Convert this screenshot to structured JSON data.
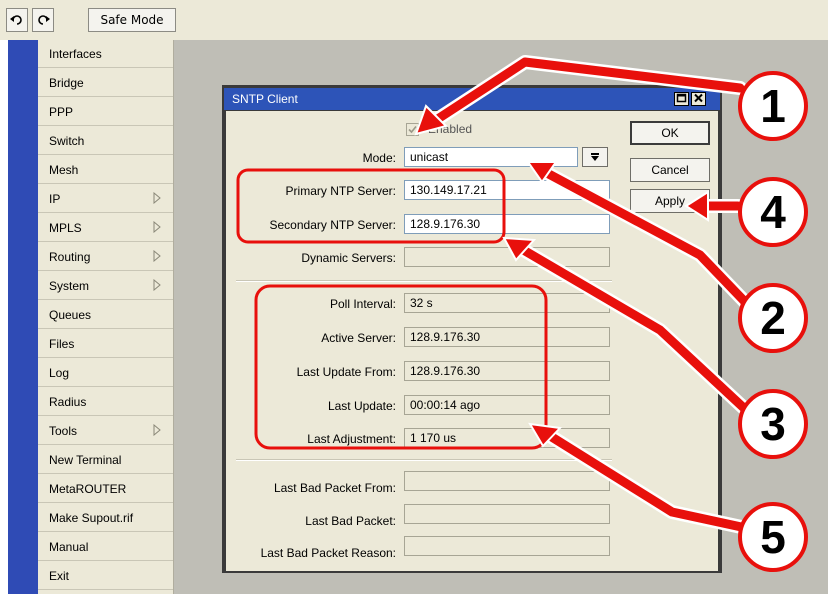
{
  "toolbar": {
    "undo_icon": "undo-icon",
    "redo_icon": "redo-icon",
    "safe_mode": "Safe Mode"
  },
  "menu": [
    "Interfaces",
    "Bridge",
    "PPP",
    "Switch",
    "Mesh",
    "IP",
    "MPLS",
    "Routing",
    "System",
    "Queues",
    "Files",
    "Log",
    "Radius",
    "Tools",
    "New Terminal",
    "MetaROUTER",
    "Make Supout.rif",
    "Manual",
    "Exit"
  ],
  "menu_submenus": [
    "IP",
    "MPLS",
    "Routing",
    "System",
    "Tools"
  ],
  "window": {
    "title": "SNTP Client",
    "enabled_label": "Enabled",
    "mode_label": "Mode:",
    "mode_value": "unicast",
    "primary_label": "Primary NTP Server:",
    "primary_value": "130.149.17.21",
    "secondary_label": "Secondary NTP Server:",
    "secondary_value": "128.9.176.30",
    "dynamic_label": "Dynamic Servers:",
    "dynamic_value": "",
    "poll_label": "Poll Interval:",
    "poll_value": "32 s",
    "active_label": "Active Server:",
    "active_value": "128.9.176.30",
    "last_from_label": "Last Update From:",
    "last_from_value": "128.9.176.30",
    "last_update_label": "Last Update:",
    "last_update_value": "00:00:14 ago",
    "last_adj_label": "Last Adjustment:",
    "last_adj_value": "1 170 us",
    "bad_from_label": "Last Bad Packet From:",
    "bad_from_value": "",
    "bad_label": "Last Bad Packet:",
    "bad_value": "",
    "bad_reason_label": "Last Bad Packet Reason:",
    "bad_reason_value": "",
    "ok": "OK",
    "cancel": "Cancel",
    "apply": "Apply"
  },
  "callouts": [
    "1",
    "2",
    "3",
    "4",
    "5"
  ],
  "colors": {
    "callout_red": "#e8100c",
    "title_blue": "#2d54b8",
    "sidebar_blue": "#2f4bb5"
  }
}
